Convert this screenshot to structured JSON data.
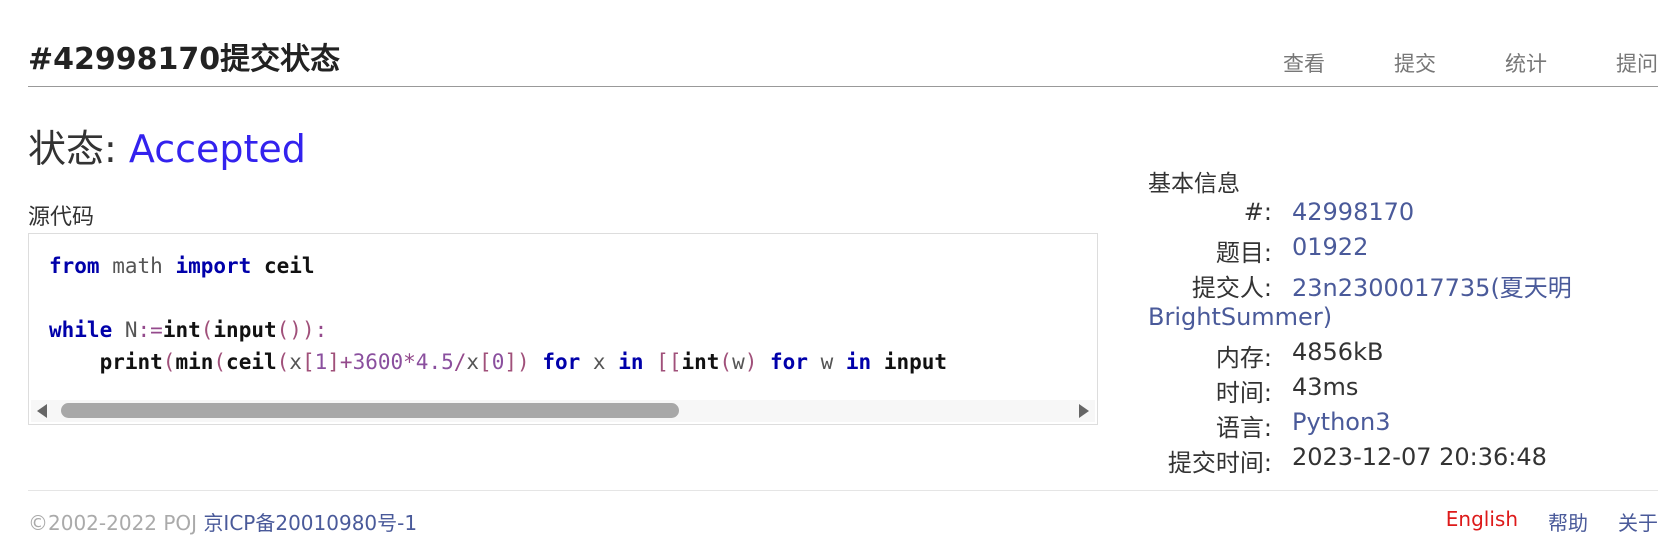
{
  "page": {
    "title": "#42998170提交状态",
    "status_label": "状态:",
    "status_value": "Accepted",
    "source_label": "源代码"
  },
  "nav": [
    {
      "label": "查看"
    },
    {
      "label": "提交"
    },
    {
      "label": "统计"
    },
    {
      "label": "提问"
    }
  ],
  "code": {
    "language": "Python3",
    "line1": "from math import ceil",
    "line2": "",
    "line3": "while N:=int(input()):",
    "line4": "    print(min(ceil(x[1]+3600*4.5/x[0]) for x in [[int(w) for w in input"
  },
  "info": {
    "heading": "基本信息",
    "id_label": "#:",
    "id_value": "42998170",
    "problem_label": "题目:",
    "problem_value": "01922",
    "submitter_label": "提交人:",
    "submitter_value_1": "23n2300017735(夏天明",
    "submitter_value_2": "BrightSummer)",
    "memory_label": "内存:",
    "memory_value": "4856kB",
    "time_label": "时间:",
    "time_value": "43ms",
    "lang_label": "语言:",
    "lang_value": "Python3",
    "submit_time_label": "提交时间:",
    "submit_time_value": "2023-12-07 20:36:48"
  },
  "footer": {
    "copyright": "©2002-2022 POJ",
    "icp": "京ICP备20010980号-1",
    "english": "English",
    "help": "帮助",
    "about": "关于"
  },
  "colors": {
    "accepted": "#3322ee",
    "link": "#4a5a9a",
    "english": "#dd1a1a",
    "keyword": "#0000aa"
  }
}
